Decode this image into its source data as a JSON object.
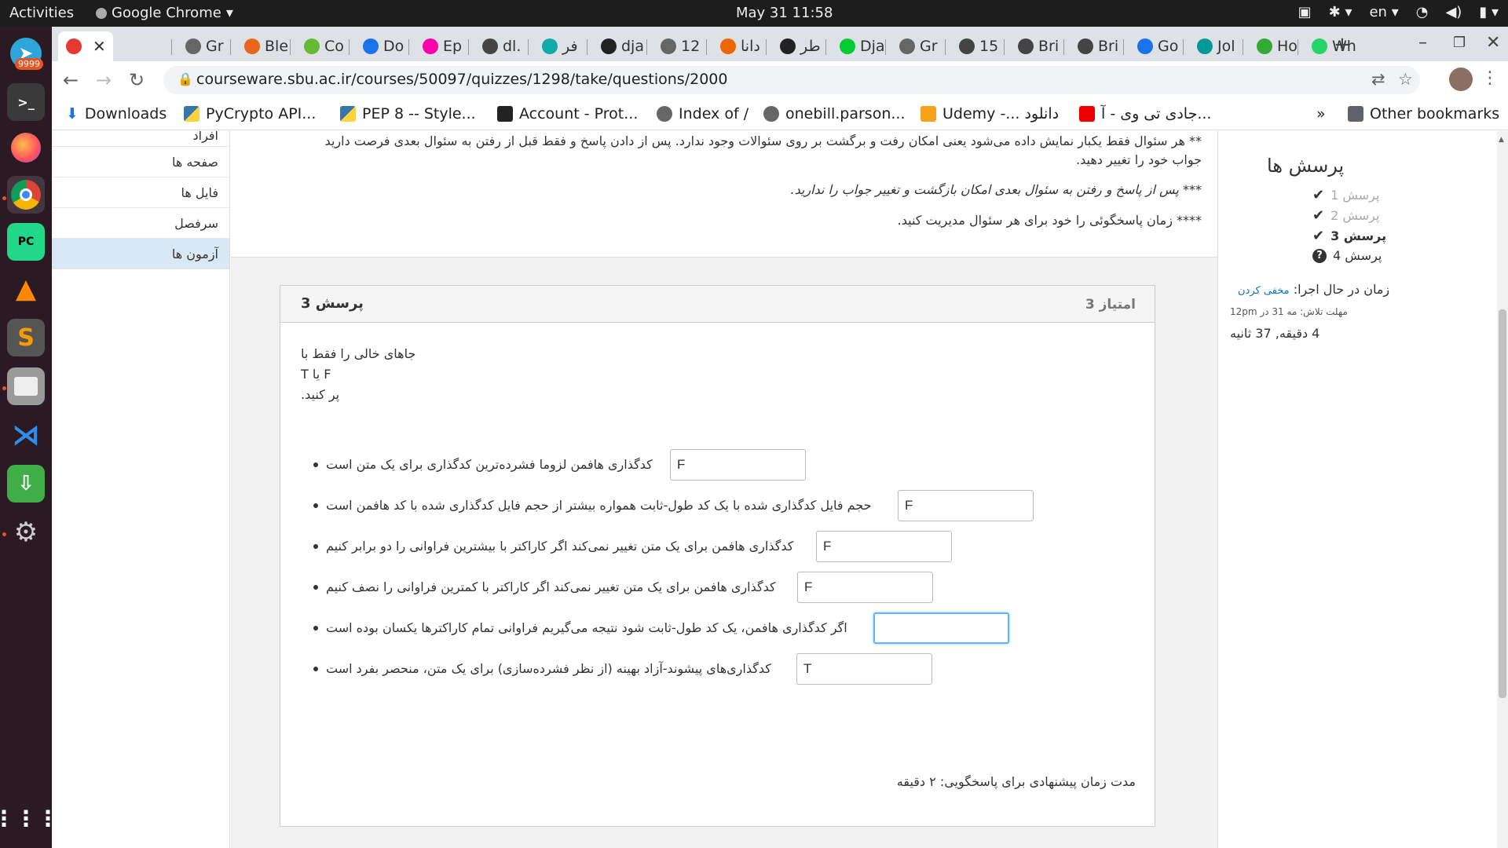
{
  "os": {
    "activities": "Activities",
    "app_name": "Google Chrome",
    "clock": "May 31  11:58",
    "lang": "en",
    "dock_badge": "9999"
  },
  "browser": {
    "active_tab_title": "",
    "tabs": [
      "Gr",
      "Ble",
      "Co",
      "Do",
      "Ep",
      "dl.",
      "فر",
      "dja",
      "12",
      "دانا",
      "طر",
      "Dja",
      "Gr",
      "15",
      "Bri",
      "Bri",
      "Go",
      "Jol",
      "Ho",
      "Wh"
    ],
    "url": "courseware.sbu.ac.ir/courses/50097/quizzes/1298/take/questions/2000",
    "bookmarks": [
      "Downloads",
      "PyCrypto API...",
      "PEP 8 -- Style...",
      "Account - Prot...",
      "Index of /",
      "onebill.parson...",
      "Udemy -... دانلود",
      "جادی تی وی - آ...",
      "»",
      "Other bookmarks"
    ]
  },
  "leftnav": {
    "items": [
      "افراد",
      "صفحه ها",
      "فایل ها",
      "سرفصل",
      "آزمون ها"
    ]
  },
  "instructions": {
    "line1": "** هر سئوال فقط یکبار نمایش داده می‌شود یعنی امکان رفت و برگشت بر روی سئوالات وجود ندارد. پس از دادن پاسخ و فقط قبل از رفتن به سئوال بعدی فرصت دارید",
    "line2": "جواب خود را تغییر دهید.",
    "line3": "*** پس از پاسخ و رفتن به سئوال بعدی امکان بازگشت و تغییر جواب را ندارید.",
    "line4": "**** زمان پاسخگوئی را خود برای هر سئوال مدیریت کنید."
  },
  "question": {
    "title": "پرسش 3",
    "score": "امتیاز 3",
    "instr1": "جاهای خالی را فقط با",
    "instr2": "T یا F",
    "instr3": ".پر کنید",
    "items": [
      {
        "text": "کدگذاری هافمن لزوما فشرده‌ترین کدگذاری برای یک متن است",
        "value": "F"
      },
      {
        "text": "حجم فایل کدگذاری شده با یک کد طول-ثابت همواره بیشتر از حجم فایل کدگذاری شده با کد هافمن است",
        "value": "F"
      },
      {
        "text": "کدگذاری هافمن برای یک متن تغییر نمی‌کند اگر کاراکتر با بیشترین فراوانی را دو برابر کنیم",
        "value": "F"
      },
      {
        "text": "کدگذاری هافمن برای یک متن تغییر نمی‌کند اگر کاراکتر با کمترین فراوانی را نصف کنیم",
        "value": "F"
      },
      {
        "text": "اگر کدگذاری هافمن، یک کد طول-ثابت شود نتیجه می‌گیریم فراوانی تمام کاراکترها یکسان بوده است",
        "value": ""
      },
      {
        "text": "کدگذاری‌های پیشوند-آزاد بهینه (از نظر فشرده‌سازی) برای یک متن، منحصر بفرد است ",
        "value": "T"
      }
    ],
    "suggested_time": "مدت زمان پیشنهادی برای پاسخگویی: ۲ دقیقه"
  },
  "sidebar": {
    "title": "پرسش ها",
    "questions": [
      "پرسش 1",
      "پرسش 2",
      "پرسش 3",
      "پرسش 4"
    ],
    "timer_label": "زمان در حال اجرا:",
    "hide_label": "مخفی کردن",
    "deadline": "مهلت تلاش: مه 31 در 12pm",
    "remaining": "4 دقیقه, 37 ثانیه"
  }
}
